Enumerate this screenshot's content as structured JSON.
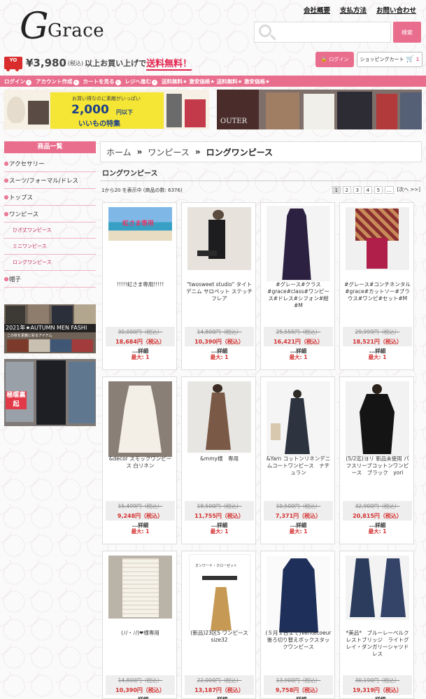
{
  "brand": {
    "logo_letter": "G",
    "logo_text": "Grace"
  },
  "top_links": [
    "会社概要",
    "支払方法",
    "お問い合わせ"
  ],
  "search": {
    "button": "検索",
    "placeholder": ""
  },
  "shipping": {
    "price": "¥3,980",
    "tax": "(税込)",
    "text": "以上お買い上げで",
    "highlight": "送料無料！"
  },
  "account": {
    "login": "ログイン",
    "cart": "ショッピングカート",
    "cart_count": "1"
  },
  "nav": [
    "ログイン",
    "アカウント作成",
    "カートを見る",
    "レジへ進む",
    "送料無料★ 激安価格★ 送料無料★ 激安価格★"
  ],
  "banners": {
    "b1_line1": "お買い得なのに素敵がいっぱい",
    "b1_price": "2,000",
    "b1_unit": "円以下",
    "b1_line3": "いいもの特集",
    "b2_label": "OUTER"
  },
  "sidebar": {
    "heading": "商品一覧",
    "items": [
      "アクセサリー",
      "スーツ/フォーマル/ドレス",
      "トップス",
      "ワンピース"
    ],
    "subs": [
      "ひざ丈ワンピース",
      "ミニワンピース",
      "ロングワンピース"
    ],
    "last": "帽子"
  },
  "ads": {
    "ad1_text": "2021年★AUTUMN MEN FASHI",
    "ad1_sub": "この秋を素敵に彩るアイテム",
    "ad2_text": "極暖裏起"
  },
  "breadcrumb": {
    "home": "ホーム",
    "mid": "ワンピース",
    "current": "ロングワンピース"
  },
  "page_title": "ロングワンピース",
  "result_count": "1から20 を表示中 (商品の数: 6376)",
  "pager": [
    "1",
    "2",
    "3",
    "4",
    "5",
    "...",
    "[次へ >>]"
  ],
  "products": [
    {
      "name": "!!!!!虹さま専用!!!!!",
      "orig": "30,000円（税込）",
      "price": "18,684円（税込）",
      "photo_text": "虹さま専用"
    },
    {
      "name": "\"twosweet studio\" タイトデニム サロペット ステッチフレア",
      "orig": "14,800円（税込）",
      "price": "10,390円（税込）"
    },
    {
      "name": "#グレース#クラス#grace#class#ワンピース#ドレス#シフォン#紺#M",
      "orig": "25,555円（税込）",
      "price": "16,421円（税込）"
    },
    {
      "name": "#グレース#コンチネンタル#grace#カットソー#ブラウス#ワンピ#セット#M",
      "orig": "29,999円（税込）",
      "price": "18,521円（税込）"
    },
    {
      "name": "&decor スモックワンピース 白リネン",
      "orig": "15,499円（税込）",
      "price": "9,248円（税込）"
    },
    {
      "name": "&mmy様　専用",
      "orig": "18,500円（税込）",
      "price": "11,755円（税込）"
    },
    {
      "name": "&Yarn コットンリネンデニムコートワンピース　ナチュラン",
      "orig": "10,500円（税込）",
      "price": "7,371円（税込）"
    },
    {
      "name": "(5/2迄)ヨリ 新品未使用 パフスリーブコットンワンピース　ブラック　yori",
      "orig": "32,900円（税込）",
      "price": "20,815円（税込）"
    },
    {
      "name": "(ﾉ/・ﾉ/)❤様専用",
      "orig": "14,800円（税込）",
      "price": "10,390円（税込）"
    },
    {
      "name": "(新品)23区S ワンピース size32",
      "orig": "22,000円（税込）",
      "price": "13,187円（税込）",
      "photo_text": "オンワード・クローゼット"
    },
    {
      "name": "(５月１日まで)Veritecoeur 後ろ切り替えボックスタックワンピース",
      "orig": "13,900円（税込）",
      "price": "9,758円（税込）"
    },
    {
      "name": "*美品*　ブルーレーベルクレストブリッジ　ライトグレイ・ダンガリーシャツドレス",
      "orig": "30,190円（税込）",
      "price": "19,319円（税込）"
    }
  ],
  "detail_label": "...詳細",
  "max_label": "最大: 1",
  "colors": {
    "accent": "#e96e8d",
    "sale": "#d43030"
  }
}
